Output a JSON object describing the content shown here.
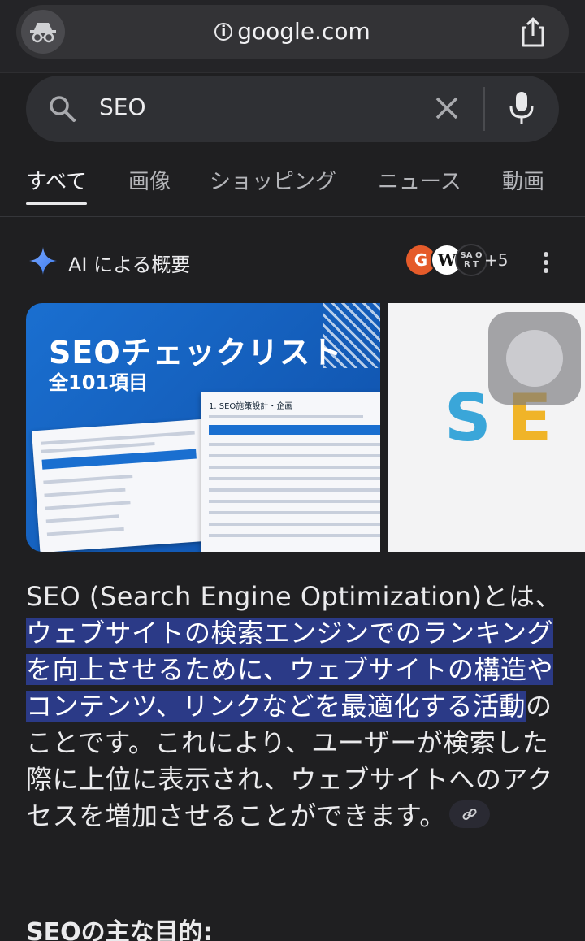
{
  "browser": {
    "url": "google.com"
  },
  "search": {
    "query": "SEO"
  },
  "tabs": [
    {
      "label": "すべて",
      "active": true
    },
    {
      "label": "画像",
      "active": false
    },
    {
      "label": "ショッピング",
      "active": false
    },
    {
      "label": "ニュース",
      "active": false
    },
    {
      "label": "動画",
      "active": false
    }
  ],
  "ai_overview": {
    "title": "AI による概要",
    "sources": {
      "fav1": "G",
      "fav2": "W",
      "fav3": "SA O R T",
      "more": "+5"
    }
  },
  "images": {
    "img1": {
      "heading": "SEOチェックリスト",
      "subheading": "全101項目",
      "sheet_title": "1. SEO施策設計・企画"
    },
    "img2": {
      "s": "S",
      "e": "E"
    }
  },
  "overview": {
    "text_before": "SEO (Search Engine Optimization)とは、",
    "highlighted": "ウェブサイトの検索エンジンでのランキングを向上させるために、ウェブサイトの構造やコンテンツ、リンクなどを最適化する活動",
    "text_after": "のことです。これにより、ユーザーが検索した際に上位に表示され、ウェブサイトへのアクセスを増加させることができます。",
    "subheading": "SEOの主な目的:"
  },
  "colors": {
    "background": "#1f1f21",
    "highlight": "#2b3a87",
    "accent_blue": "#1a6fd0"
  }
}
